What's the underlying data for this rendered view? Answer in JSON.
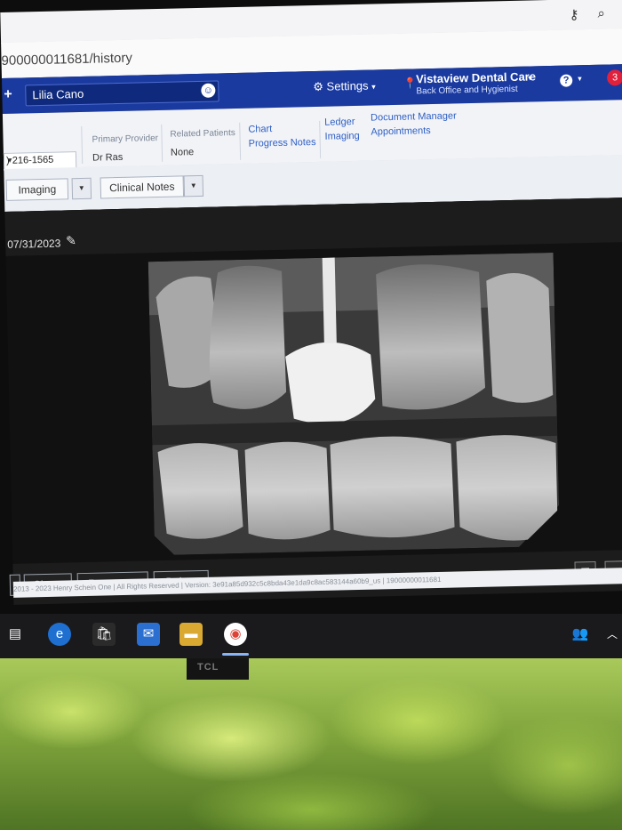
{
  "browser": {
    "url": "900000011681/history",
    "key_icon": "key-icon",
    "zoom_icon": "zoom-icon"
  },
  "header": {
    "add_symbol": "+",
    "patient_name": "Lilia Cano",
    "settings_label": "Settings",
    "location_name": "Vistaview Dental Care",
    "location_role": "Back Office and Hygienist",
    "help_symbol": "?",
    "notification_count": "3",
    "colors": {
      "header_bg": "#1a3aa0",
      "badge": "#e1203c",
      "link": "#2f5fc4"
    }
  },
  "patient_info": {
    "phone": ") 216-1565",
    "primary_provider_label": "Primary Provider",
    "primary_provider_value": "Dr Ras",
    "related_patients_label": "Related Patients",
    "related_patients_value": "None",
    "links": {
      "chart": "Chart",
      "progress_notes": "Progress Notes",
      "ledger": "Ledger",
      "imaging": "Imaging",
      "document_manager": "Document Manager",
      "appointments": "Appointments"
    }
  },
  "toolbar": {
    "imaging_label": "Imaging",
    "clinical_notes_label": "Clinical Notes"
  },
  "viewer": {
    "image_date": "07/31/2023",
    "share_label": "Share",
    "recapture_label": "Recapture",
    "delete_label": "Delete"
  },
  "footer": {
    "text": "2013 - 2023 Henry Schein One | All Rights Reserved | Version: 3e91a85d932c5c8bda43e1da9c8ac583144a60b9_us | 19000000011681"
  },
  "monitor": {
    "brand": "TCL"
  }
}
